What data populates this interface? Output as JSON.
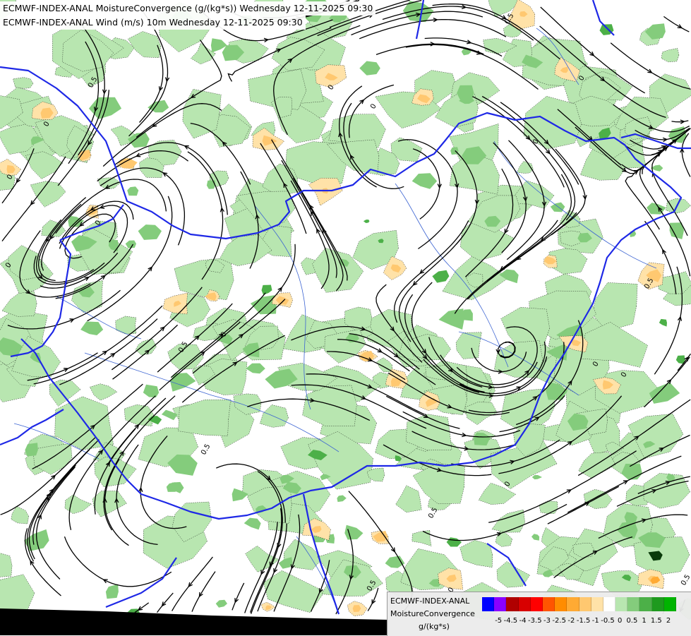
{
  "titles": {
    "line1": "ECMWF-INDEX-ANAL MoistureConvergence (g/(kg*s)) Wednesday 12-11-2025 09:30",
    "line2": "ECMWF-INDEX-ANAL Wind (m/s) 10m Wednesday 12-11-2025 09:30"
  },
  "legend": {
    "line1": "ECMWF-INDEX-ANAL",
    "line2": "MoistureConvergence",
    "line3": "g/(kg*s)",
    "colors": [
      "#0000ff",
      "#8a00ff",
      "#b00000",
      "#d80000",
      "#ff0000",
      "#ff5500",
      "#ff8c00",
      "#ffaa33",
      "#ffc870",
      "#ffe2a8",
      "#ffffff",
      "#b8e6b0",
      "#84cc7c",
      "#4cb048",
      "#1e9a1e",
      "#00b400"
    ],
    "ticks": [
      "-5",
      "-4.5",
      "-4",
      "-3.5",
      "-3",
      "-2.5",
      "-2",
      "-1.5",
      "-1",
      "-0.5",
      "0",
      "0.5",
      "1",
      "1.5",
      "2"
    ]
  },
  "map": {
    "contour_labels": [
      "0.5",
      "0",
      "0",
      "0",
      "0.5",
      "0",
      "0",
      "0",
      "0",
      "0.5",
      "0.5",
      "0",
      "0",
      "0.5",
      "0",
      "0.5",
      "0",
      "0.5",
      "0",
      "0",
      "0.5"
    ],
    "colors": {
      "border": "#1e28e6",
      "river": "#3c64d2",
      "streamline": "#000000",
      "green_light": "#b8e6b0",
      "green_mid": "#84cc7c",
      "green_dark": "#4cb048",
      "orange_light": "#ffe2a8",
      "orange_mid": "#ffc870",
      "orange_dark": "#ffaa33"
    }
  }
}
